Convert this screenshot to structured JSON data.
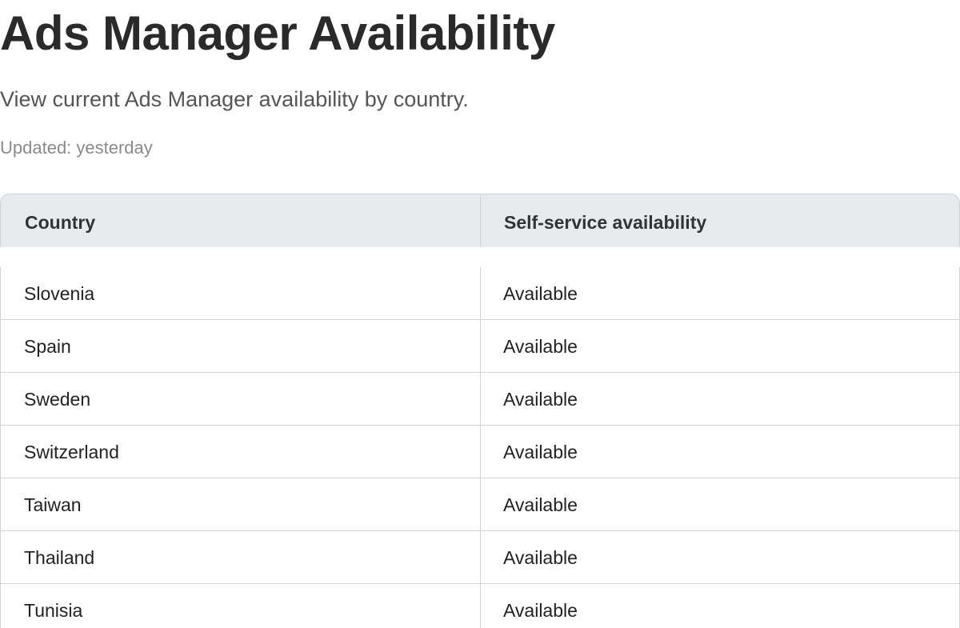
{
  "header": {
    "title": "Ads Manager Availability",
    "subtitle": "View current Ads Manager availability by country.",
    "updated": "Updated: yesterday"
  },
  "table": {
    "columns": [
      "Country",
      "Self-service availability"
    ],
    "rows": [
      {
        "country": "Slovenia",
        "availability": "Available"
      },
      {
        "country": "Spain",
        "availability": "Available"
      },
      {
        "country": "Sweden",
        "availability": "Available"
      },
      {
        "country": "Switzerland",
        "availability": "Available"
      },
      {
        "country": "Taiwan",
        "availability": "Available"
      },
      {
        "country": "Thailand",
        "availability": "Available"
      },
      {
        "country": "Tunisia",
        "availability": "Available"
      }
    ]
  },
  "colors": {
    "header_bg": "#e8ebee",
    "border": "#cfd3d7",
    "title_text": "#2a2a2a",
    "subtitle_text": "#555555",
    "muted_text": "#8a8a8a"
  }
}
